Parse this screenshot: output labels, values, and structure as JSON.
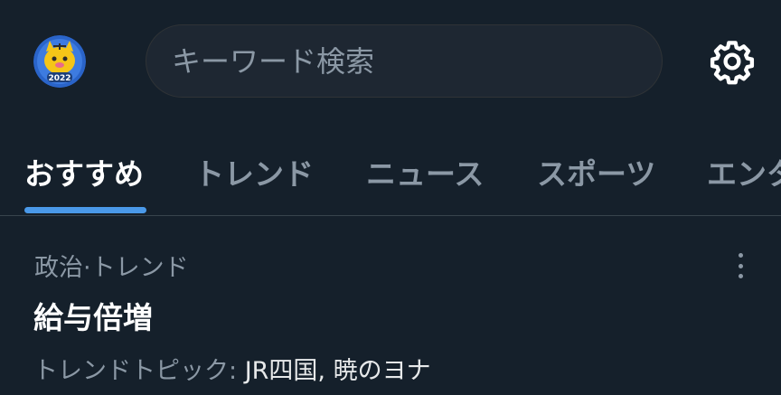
{
  "header": {
    "avatar_badge": "2022",
    "search": {
      "placeholder": "キーワード検索",
      "value": ""
    },
    "settings_icon": "gear-icon"
  },
  "tabs": [
    {
      "label": "おすすめ",
      "active": true
    },
    {
      "label": "トレンド",
      "active": false
    },
    {
      "label": "ニュース",
      "active": false
    },
    {
      "label": "スポーツ",
      "active": false
    },
    {
      "label": "エンタ",
      "active": false
    }
  ],
  "trend_item": {
    "category": "政治·トレンド",
    "title": "給与倍増",
    "topics_label": "トレンドトピック:",
    "topics": "JR四国, 暁のヨナ",
    "more_icon": "more-vertical-icon"
  },
  "colors": {
    "background": "#15202b",
    "accent": "#4a99e9",
    "muted_text": "#8b98a5",
    "divider": "#38444d"
  }
}
